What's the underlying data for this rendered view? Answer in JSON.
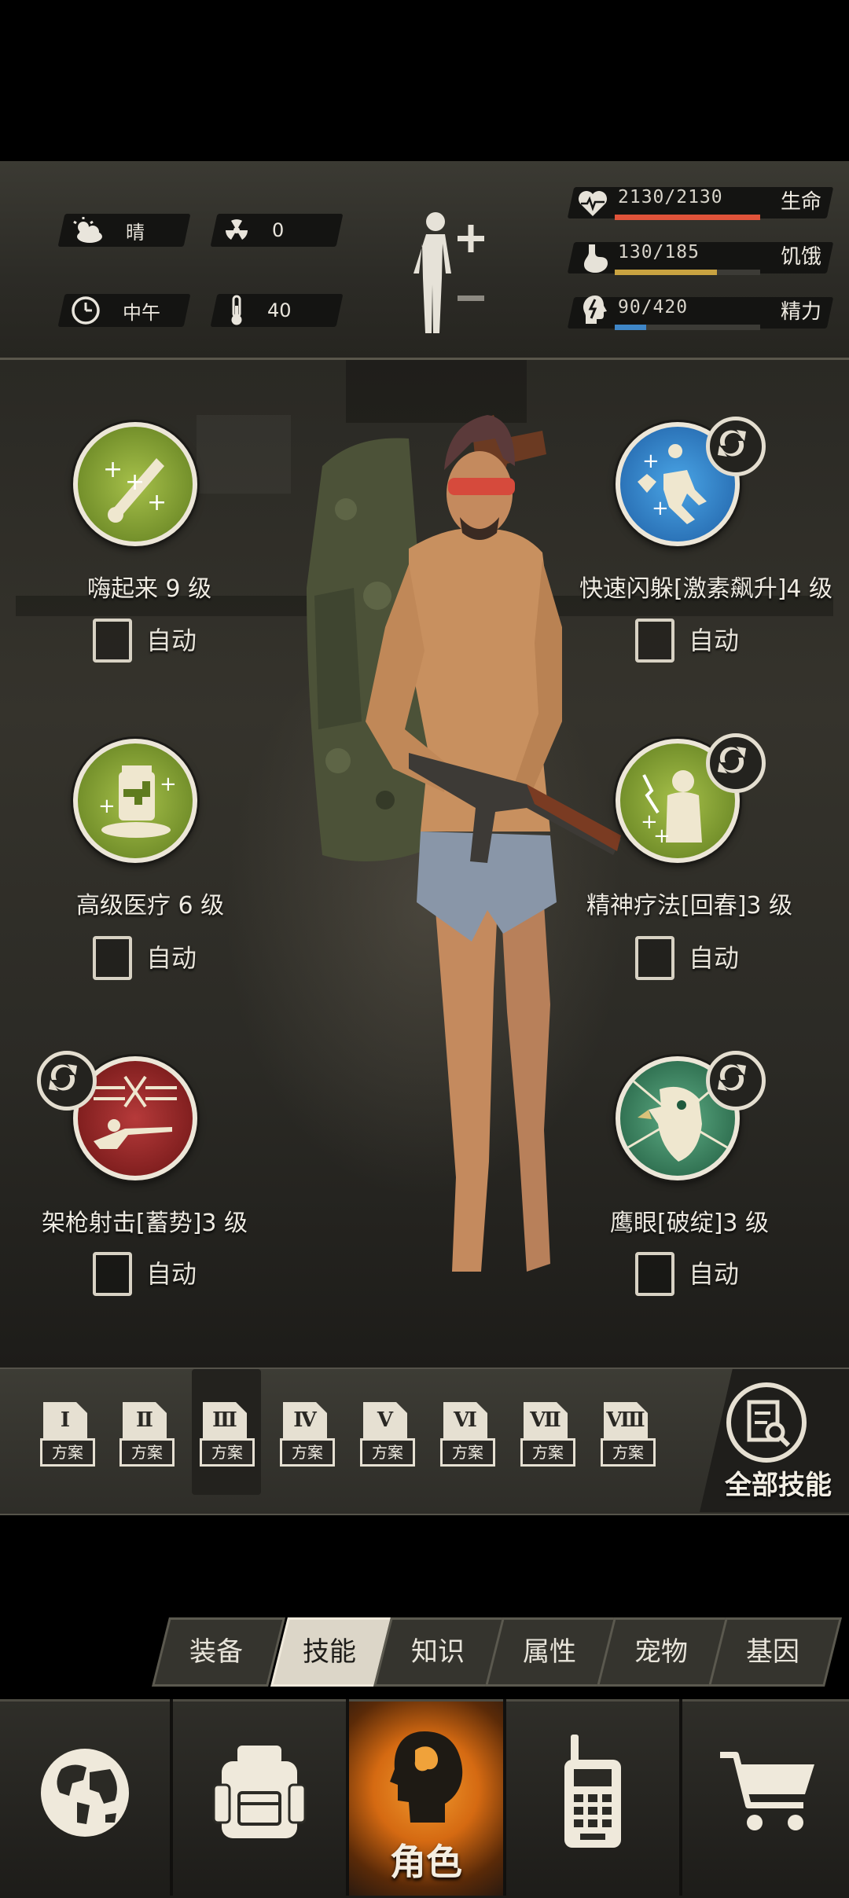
{
  "environment": {
    "weather": "晴",
    "radiation": "0",
    "time_of_day": "中午",
    "temperature": "40"
  },
  "stats": [
    {
      "name": "生命",
      "value": "2130/2130",
      "fill": 1.0,
      "color": "#e0533a"
    },
    {
      "name": "饥饿",
      "value": "130/185",
      "fill": 0.7,
      "color": "#c9a341"
    },
    {
      "name": "精力",
      "value": "90/420",
      "fill": 0.21,
      "color": "#3f86c7"
    }
  ],
  "skills": [
    {
      "name": "嗨起来 9 级",
      "auto_label": "自动",
      "auto_checked": false,
      "color": "#7a9a2e"
    },
    {
      "name": "快速闪躲[激素飙升]4 级",
      "auto_label": "自动",
      "auto_checked": false,
      "color": "#2b7fc4"
    },
    {
      "name": "高级医疗 6 级",
      "auto_label": "自动",
      "auto_checked": false,
      "color": "#7a9a2e"
    },
    {
      "name": "精神疗法[回春]3 级",
      "auto_label": "自动",
      "auto_checked": false,
      "color": "#7a9a2e"
    },
    {
      "name": "架枪射击[蓄势]3 级",
      "auto_label": "自动",
      "auto_checked": false,
      "color": "#8a1f1f"
    },
    {
      "name": "鹰眼[破绽]3 级",
      "auto_label": "自动",
      "auto_checked": false,
      "color": "#2f7a5a"
    }
  ],
  "presets": {
    "items": [
      {
        "numeral": "Ⅰ",
        "label": "方案"
      },
      {
        "numeral": "Ⅱ",
        "label": "方案"
      },
      {
        "numeral": "Ⅲ",
        "label": "方案"
      },
      {
        "numeral": "Ⅳ",
        "label": "方案"
      },
      {
        "numeral": "Ⅴ",
        "label": "方案"
      },
      {
        "numeral": "Ⅵ",
        "label": "方案"
      },
      {
        "numeral": "Ⅶ",
        "label": "方案"
      },
      {
        "numeral": "Ⅷ",
        "label": "方案"
      }
    ],
    "selected_index": 2,
    "all_skills_label": "全部技能"
  },
  "tabs": {
    "items": [
      "装备",
      "技能",
      "知识",
      "属性",
      "宠物",
      "基因"
    ],
    "active": "技能"
  },
  "nav": {
    "items": [
      {
        "icon": "globe-icon"
      },
      {
        "icon": "backpack-icon"
      },
      {
        "icon": "character-head-icon",
        "label": "角色"
      },
      {
        "icon": "walkie-talkie-icon"
      },
      {
        "icon": "shopping-cart-icon"
      }
    ],
    "active": "角色"
  },
  "colors": {
    "accent_orange": "#e07a1f",
    "panel_dark": "#2c2b26"
  }
}
